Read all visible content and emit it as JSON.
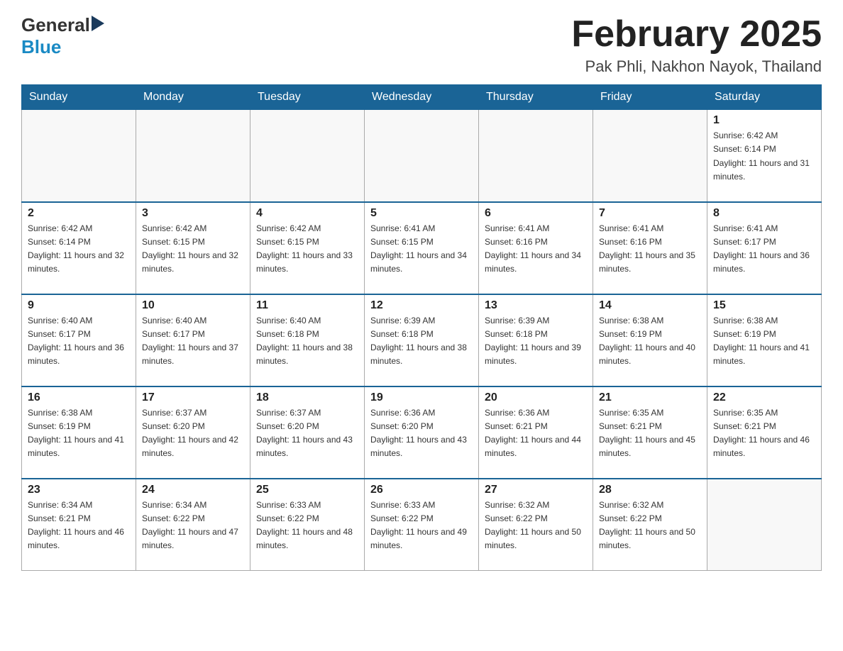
{
  "logo": {
    "general": "General",
    "blue": "Blue"
  },
  "title": "February 2025",
  "subtitle": "Pak Phli, Nakhon Nayok, Thailand",
  "weekdays": [
    "Sunday",
    "Monday",
    "Tuesday",
    "Wednesday",
    "Thursday",
    "Friday",
    "Saturday"
  ],
  "weeks": [
    [
      {
        "day": "",
        "sunrise": "",
        "sunset": "",
        "daylight": ""
      },
      {
        "day": "",
        "sunrise": "",
        "sunset": "",
        "daylight": ""
      },
      {
        "day": "",
        "sunrise": "",
        "sunset": "",
        "daylight": ""
      },
      {
        "day": "",
        "sunrise": "",
        "sunset": "",
        "daylight": ""
      },
      {
        "day": "",
        "sunrise": "",
        "sunset": "",
        "daylight": ""
      },
      {
        "day": "",
        "sunrise": "",
        "sunset": "",
        "daylight": ""
      },
      {
        "day": "1",
        "sunrise": "Sunrise: 6:42 AM",
        "sunset": "Sunset: 6:14 PM",
        "daylight": "Daylight: 11 hours and 31 minutes."
      }
    ],
    [
      {
        "day": "2",
        "sunrise": "Sunrise: 6:42 AM",
        "sunset": "Sunset: 6:14 PM",
        "daylight": "Daylight: 11 hours and 32 minutes."
      },
      {
        "day": "3",
        "sunrise": "Sunrise: 6:42 AM",
        "sunset": "Sunset: 6:15 PM",
        "daylight": "Daylight: 11 hours and 32 minutes."
      },
      {
        "day": "4",
        "sunrise": "Sunrise: 6:42 AM",
        "sunset": "Sunset: 6:15 PM",
        "daylight": "Daylight: 11 hours and 33 minutes."
      },
      {
        "day": "5",
        "sunrise": "Sunrise: 6:41 AM",
        "sunset": "Sunset: 6:15 PM",
        "daylight": "Daylight: 11 hours and 34 minutes."
      },
      {
        "day": "6",
        "sunrise": "Sunrise: 6:41 AM",
        "sunset": "Sunset: 6:16 PM",
        "daylight": "Daylight: 11 hours and 34 minutes."
      },
      {
        "day": "7",
        "sunrise": "Sunrise: 6:41 AM",
        "sunset": "Sunset: 6:16 PM",
        "daylight": "Daylight: 11 hours and 35 minutes."
      },
      {
        "day": "8",
        "sunrise": "Sunrise: 6:41 AM",
        "sunset": "Sunset: 6:17 PM",
        "daylight": "Daylight: 11 hours and 36 minutes."
      }
    ],
    [
      {
        "day": "9",
        "sunrise": "Sunrise: 6:40 AM",
        "sunset": "Sunset: 6:17 PM",
        "daylight": "Daylight: 11 hours and 36 minutes."
      },
      {
        "day": "10",
        "sunrise": "Sunrise: 6:40 AM",
        "sunset": "Sunset: 6:17 PM",
        "daylight": "Daylight: 11 hours and 37 minutes."
      },
      {
        "day": "11",
        "sunrise": "Sunrise: 6:40 AM",
        "sunset": "Sunset: 6:18 PM",
        "daylight": "Daylight: 11 hours and 38 minutes."
      },
      {
        "day": "12",
        "sunrise": "Sunrise: 6:39 AM",
        "sunset": "Sunset: 6:18 PM",
        "daylight": "Daylight: 11 hours and 38 minutes."
      },
      {
        "day": "13",
        "sunrise": "Sunrise: 6:39 AM",
        "sunset": "Sunset: 6:18 PM",
        "daylight": "Daylight: 11 hours and 39 minutes."
      },
      {
        "day": "14",
        "sunrise": "Sunrise: 6:38 AM",
        "sunset": "Sunset: 6:19 PM",
        "daylight": "Daylight: 11 hours and 40 minutes."
      },
      {
        "day": "15",
        "sunrise": "Sunrise: 6:38 AM",
        "sunset": "Sunset: 6:19 PM",
        "daylight": "Daylight: 11 hours and 41 minutes."
      }
    ],
    [
      {
        "day": "16",
        "sunrise": "Sunrise: 6:38 AM",
        "sunset": "Sunset: 6:19 PM",
        "daylight": "Daylight: 11 hours and 41 minutes."
      },
      {
        "day": "17",
        "sunrise": "Sunrise: 6:37 AM",
        "sunset": "Sunset: 6:20 PM",
        "daylight": "Daylight: 11 hours and 42 minutes."
      },
      {
        "day": "18",
        "sunrise": "Sunrise: 6:37 AM",
        "sunset": "Sunset: 6:20 PM",
        "daylight": "Daylight: 11 hours and 43 minutes."
      },
      {
        "day": "19",
        "sunrise": "Sunrise: 6:36 AM",
        "sunset": "Sunset: 6:20 PM",
        "daylight": "Daylight: 11 hours and 43 minutes."
      },
      {
        "day": "20",
        "sunrise": "Sunrise: 6:36 AM",
        "sunset": "Sunset: 6:21 PM",
        "daylight": "Daylight: 11 hours and 44 minutes."
      },
      {
        "day": "21",
        "sunrise": "Sunrise: 6:35 AM",
        "sunset": "Sunset: 6:21 PM",
        "daylight": "Daylight: 11 hours and 45 minutes."
      },
      {
        "day": "22",
        "sunrise": "Sunrise: 6:35 AM",
        "sunset": "Sunset: 6:21 PM",
        "daylight": "Daylight: 11 hours and 46 minutes."
      }
    ],
    [
      {
        "day": "23",
        "sunrise": "Sunrise: 6:34 AM",
        "sunset": "Sunset: 6:21 PM",
        "daylight": "Daylight: 11 hours and 46 minutes."
      },
      {
        "day": "24",
        "sunrise": "Sunrise: 6:34 AM",
        "sunset": "Sunset: 6:22 PM",
        "daylight": "Daylight: 11 hours and 47 minutes."
      },
      {
        "day": "25",
        "sunrise": "Sunrise: 6:33 AM",
        "sunset": "Sunset: 6:22 PM",
        "daylight": "Daylight: 11 hours and 48 minutes."
      },
      {
        "day": "26",
        "sunrise": "Sunrise: 6:33 AM",
        "sunset": "Sunset: 6:22 PM",
        "daylight": "Daylight: 11 hours and 49 minutes."
      },
      {
        "day": "27",
        "sunrise": "Sunrise: 6:32 AM",
        "sunset": "Sunset: 6:22 PM",
        "daylight": "Daylight: 11 hours and 50 minutes."
      },
      {
        "day": "28",
        "sunrise": "Sunrise: 6:32 AM",
        "sunset": "Sunset: 6:22 PM",
        "daylight": "Daylight: 11 hours and 50 minutes."
      },
      {
        "day": "",
        "sunrise": "",
        "sunset": "",
        "daylight": ""
      }
    ]
  ]
}
